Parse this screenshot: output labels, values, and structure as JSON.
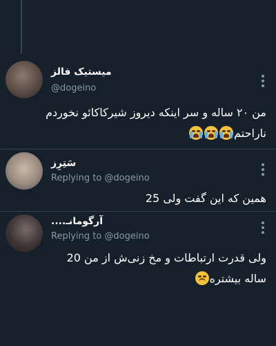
{
  "tweets": [
    {
      "name": "میستیک فالز",
      "handle": "@dogeino",
      "text_line1": "من ۲۰ ساله و سر اینکه دیروز شیرکاکائو نخوردم",
      "text_line2": "ناراحتم",
      "emoji": "loudly-crying-face"
    },
    {
      "name": "سَتِرِز",
      "reply_prefix": "Replying to @dogeino",
      "text_line1": "همین که این گفت ولی 25"
    },
    {
      "name": "آرگومانـ....",
      "reply_prefix": "Replying to @dogeino",
      "text_line1": "ولی قدرت ارتباطات و مخ زنی‌ش از من 20",
      "text_line2": "ساله بیشتره",
      "emoji": "sad-face"
    }
  ],
  "colors": {
    "background": "#15202b",
    "divider": "#38444d",
    "secondary_text": "#8899a6"
  }
}
